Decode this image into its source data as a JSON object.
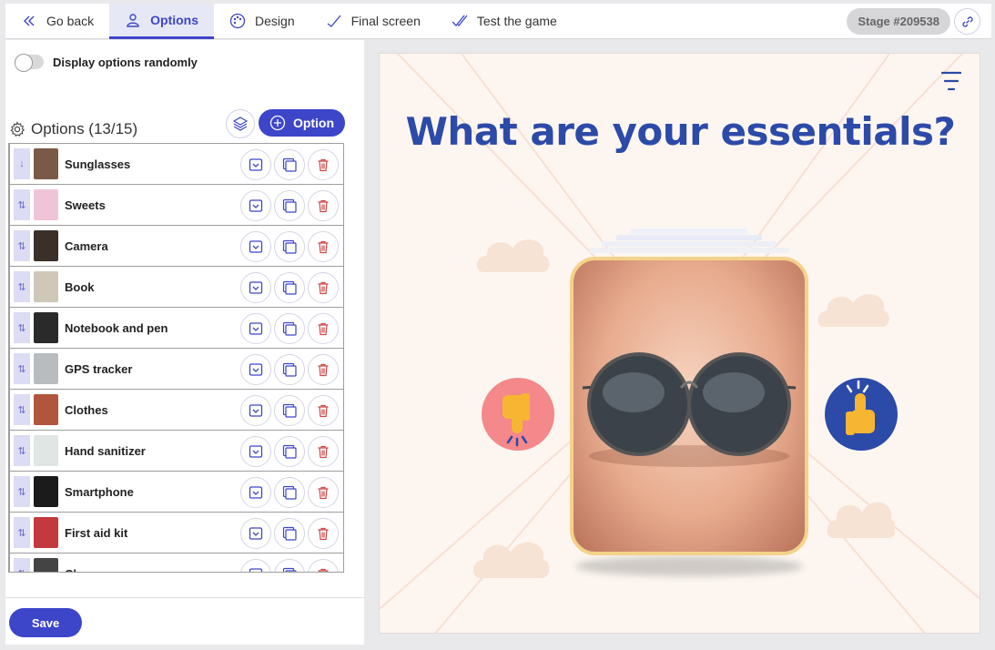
{
  "topbar": {
    "tabs": [
      {
        "label": "Go back",
        "icon": "double-chevron-left-icon"
      },
      {
        "label": "Options",
        "icon": "user-options-icon",
        "active": true
      },
      {
        "label": "Design",
        "icon": "palette-icon"
      },
      {
        "label": "Final screen",
        "icon": "checkmark-icon"
      },
      {
        "label": "Test the game",
        "icon": "double-check-icon"
      }
    ],
    "stage_badge": "Stage #209538",
    "link_icon": "link-icon"
  },
  "left_panel": {
    "toggle_label": "Display options randomly",
    "toggle_on": false,
    "options_title": "Options (13/15)",
    "add_option_label": "Option",
    "save_label": "Save",
    "options": [
      {
        "label": "Sunglasses",
        "handle": "↓"
      },
      {
        "label": "Sweets",
        "handle": "⇅"
      },
      {
        "label": "Camera",
        "handle": "⇅"
      },
      {
        "label": "Book",
        "handle": "⇅"
      },
      {
        "label": "Notebook and pen",
        "handle": "⇅"
      },
      {
        "label": "GPS tracker",
        "handle": "⇅"
      },
      {
        "label": "Clothes",
        "handle": "⇅"
      },
      {
        "label": "Hand sanitizer",
        "handle": "⇅"
      },
      {
        "label": "Smartphone",
        "handle": "⇅"
      },
      {
        "label": "First aid kit",
        "handle": "⇅"
      },
      {
        "label": "Charger",
        "handle": "⇅"
      }
    ]
  },
  "preview": {
    "question": "What are your essentials?",
    "colors": {
      "title": "#2c4aa8",
      "dislike": "#f4888a",
      "like": "#2c4aa8",
      "card_border": "#f4d28a",
      "accent": "#3d45c9"
    }
  }
}
